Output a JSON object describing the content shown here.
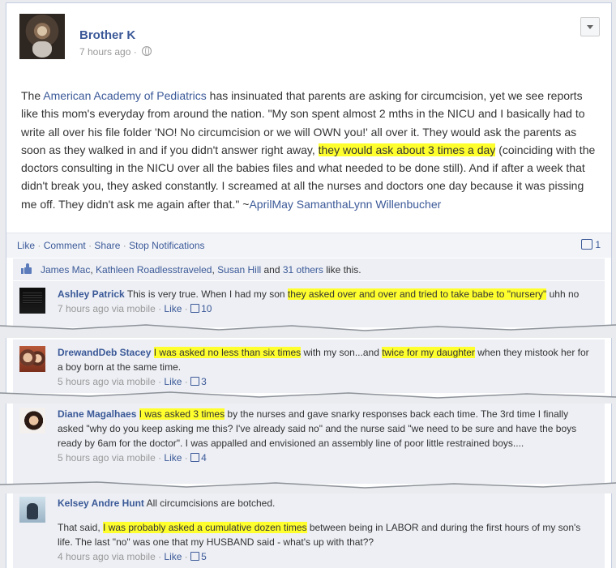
{
  "post": {
    "author": "Brother K",
    "timestamp": "7 hours ago",
    "meta_separator": "·",
    "text_before_link": "The ",
    "link": "American Academy of Pediatrics",
    "text_part1": " has insinuated that parents are asking for circumcision, yet we see reports like this mom's everyday from around the nation. \"My son spent almost 2 mths in the NICU and I basically had to write all over his file folder 'NO! No circumcision or we will OWN you!' all over it. They would ask the parents as soon as they walked in and if you didn't answer right away, ",
    "highlight": "they would ask about 3 times a day",
    "text_part2": " (coinciding with the doctors consulting in the NICU over all the babies files and what needed to be done still). And if after a week that didn't break you, they asked constantly. I screamed at all the nurses and doctors one day because it was pissing me off. They didn't ask me again after that.\" ~",
    "quoted_author": "AprilMay SamanthaLynn Willenbucher"
  },
  "actions": {
    "like": "Like",
    "comment": "Comment",
    "share": "Share",
    "stop_notifications": "Stop Notifications",
    "separator": "·",
    "comment_count": "1"
  },
  "likes": {
    "names": [
      "James Mac",
      "Kathleen Roadlesstraveled",
      "Susan Hill"
    ],
    "others": "31 others",
    "sep1": ", ",
    "and": " and ",
    "suffix": " like this."
  },
  "comments": [
    {
      "author": "Ashley Patrick",
      "text_a": " This is very true. When I had my son ",
      "highlight_a": "they asked over and over and tried to take babe to \"nursery\"",
      "text_b": " uhh no",
      "time": "7 hours ago via mobile",
      "like": "Like",
      "likes": "10"
    },
    {
      "author": "DrewandDeb Stacey",
      "highlight_a": "I was asked no less than six times",
      "text_a": " with my son...and ",
      "highlight_b": "twice for my daughter",
      "text_b": " when they mistook her for a boy born at the same time.",
      "time": "5 hours ago via mobile",
      "like": "Like",
      "likes": "3"
    },
    {
      "author": "Diane Magalhaes",
      "highlight_a": "I was asked 3 times",
      "text_a": " by the nurses and gave snarky responses back each time. The 3rd time I finally asked \"why do you keep asking me this? I've already said no\" and the nurse said \"we need to be sure and have the boys ready by 6am for the doctor\". I was appalled and envisioned an assembly line of poor little restrained boys....",
      "time": "5 hours ago via mobile",
      "like": "Like",
      "likes": "4"
    },
    {
      "author": "Kelsey Andre Hunt",
      "text_a": " All circumcisions are botched.",
      "text_b": "That said, ",
      "highlight_a": "I was probably asked a cumulative dozen times",
      "text_c": " between being in LABOR and during the first hours of my son's life. The last \"no\" was one that my HUSBAND said - what's up with that??",
      "time": "4 hours ago via mobile",
      "like": "Like",
      "likes": "5"
    }
  ],
  "colors": {
    "link": "#3b5998",
    "highlight": "#ffff2e",
    "comment_bg": "#edeff4",
    "meta_gray": "#999999"
  }
}
